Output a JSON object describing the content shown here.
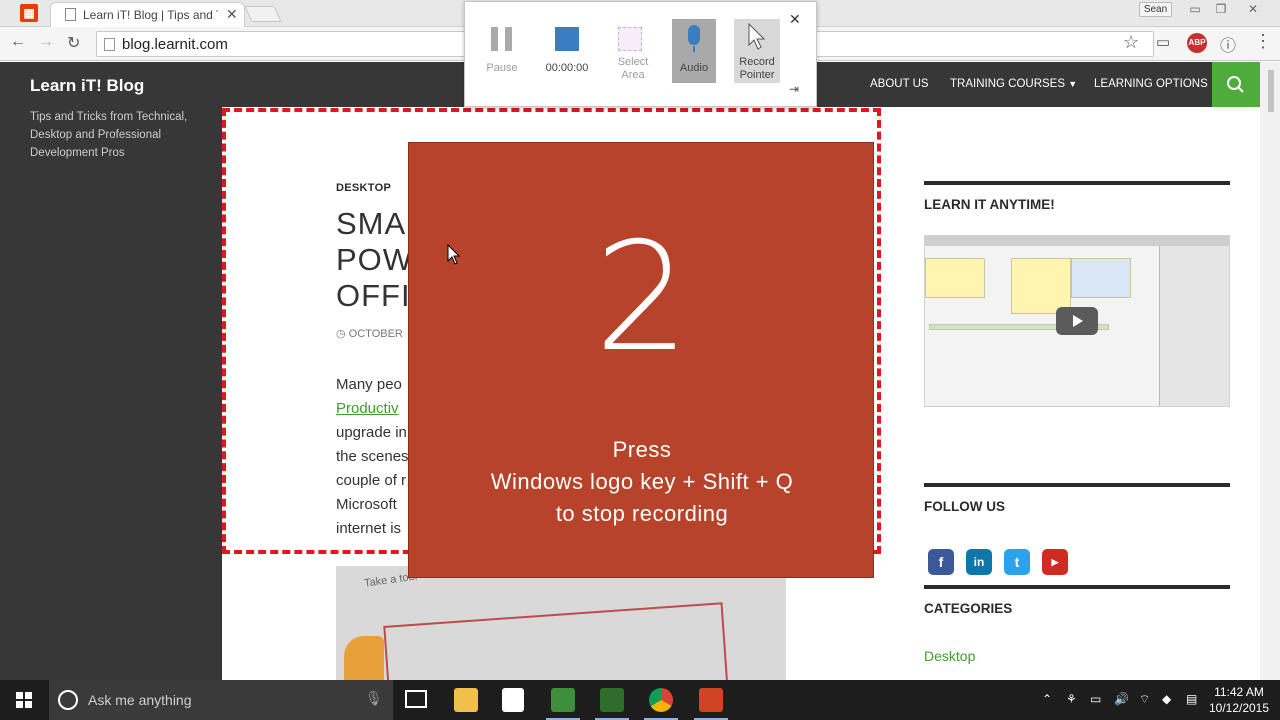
{
  "browser": {
    "tab_title": "Learn iT! Blog | Tips and Tricks",
    "profile": "Sean",
    "url": "blog.learnit.com"
  },
  "site": {
    "brand": "Learn iT! Blog",
    "tagline": "Tips and Tricks from Technical, Desktop and Professional Development Pros",
    "nav": [
      "ABOUT US",
      "TRAINING COURSES",
      "LEARNING OPTIONS"
    ]
  },
  "article": {
    "category": "DESKTOP",
    "title_lines": [
      "SMA",
      "POW",
      "OFFI"
    ],
    "date": "OCTOBER",
    "body_lines": [
      "Many peo",
      "Productiv",
      "upgrade in",
      "the scenes",
      "couple of r",
      "Microsoft",
      "internet is"
    ],
    "image_caption": "Take a tour"
  },
  "sidebar": {
    "learn_heading": "LEARN IT ANYTIME!",
    "follow_heading": "FOLLOW US",
    "categories_heading": "CATEGORIES",
    "category_link": "Desktop",
    "social": [
      "facebook-icon",
      "linkedin-icon",
      "twitter-icon",
      "youtube-icon"
    ]
  },
  "recorder": {
    "pause_label": "Pause",
    "timer": "00:00:00",
    "select_area_label": "Select Area",
    "audio_label": "Audio",
    "record_pointer_label": "Record Pointer"
  },
  "countdown": {
    "number": "2",
    "line1": "Press",
    "line2": "Windows logo key + Shift + Q",
    "line3": "to stop recording"
  },
  "taskbar": {
    "search_placeholder": "Ask me anything",
    "time": "11:42 AM",
    "date": "10/12/2015"
  },
  "colors": {
    "site_dark": "#373737",
    "accent_green": "#4eac3b",
    "countdown_bg": "#b7442a",
    "rec_border": "#e0171c",
    "recorder_blue": "#3b7dc1"
  }
}
